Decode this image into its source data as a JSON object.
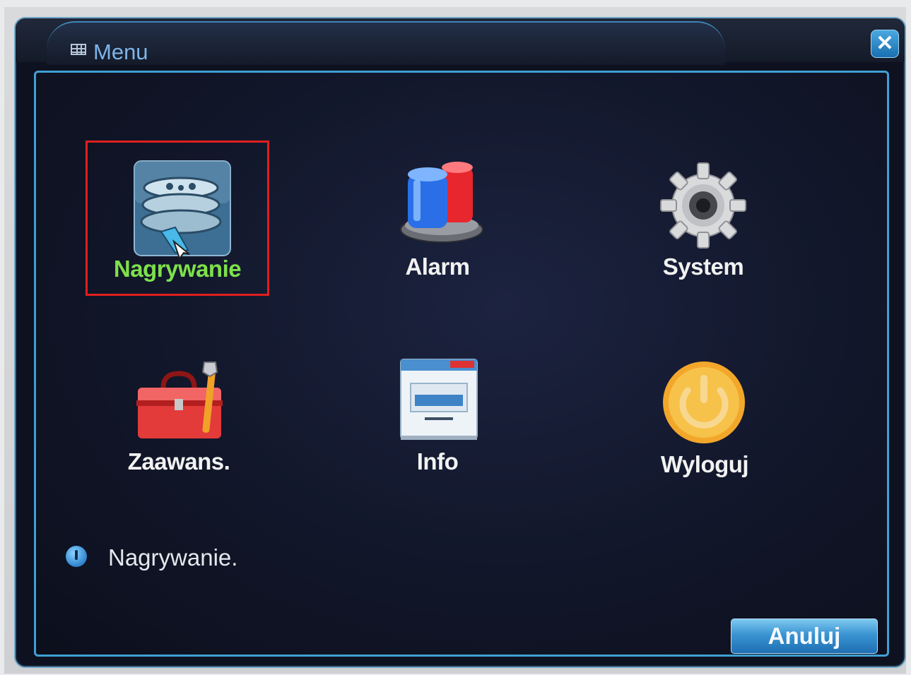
{
  "window": {
    "title": "Menu",
    "close_label": "✕"
  },
  "menu": {
    "items": [
      {
        "label": "Nagrywanie",
        "icon": "film-reels-icon",
        "selected": true
      },
      {
        "label": "Alarm",
        "icon": "alarm-siren-icon",
        "selected": false
      },
      {
        "label": "System",
        "icon": "gear-icon",
        "selected": false
      },
      {
        "label": "Zaawans.",
        "icon": "toolbox-icon",
        "selected": false
      },
      {
        "label": "Info",
        "icon": "info-window-icon",
        "selected": false
      },
      {
        "label": "Wyloguj",
        "icon": "power-icon",
        "selected": false
      }
    ]
  },
  "status": {
    "text": "Nagrywanie."
  },
  "footer": {
    "cancel_label": "Anuluj"
  },
  "colors": {
    "selected_label": "#7ee04b",
    "selection_border": "#e01f1f",
    "frame_accent": "#3fa0d4"
  }
}
